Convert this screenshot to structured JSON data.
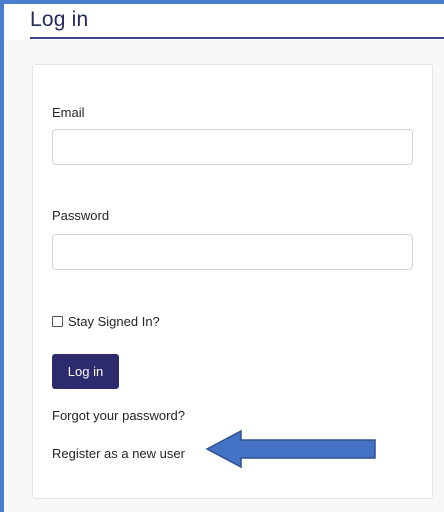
{
  "page": {
    "title": "Log in"
  },
  "form": {
    "email_label": "Email",
    "email_value": "",
    "password_label": "Password",
    "password_value": "",
    "remember_label": "Stay Signed In?",
    "remember_checked": false,
    "submit_label": "Log in"
  },
  "links": {
    "forgot_password": "Forgot your password?",
    "register": "Register as a new user"
  },
  "annotation": {
    "arrow_icon": "left-arrow-icon",
    "arrow_color": "#4472c4"
  },
  "colors": {
    "frame_border": "#4a7fcf",
    "heading": "#24295c",
    "heading_rule": "#3d4494",
    "button_bg": "#2d2a6e"
  }
}
